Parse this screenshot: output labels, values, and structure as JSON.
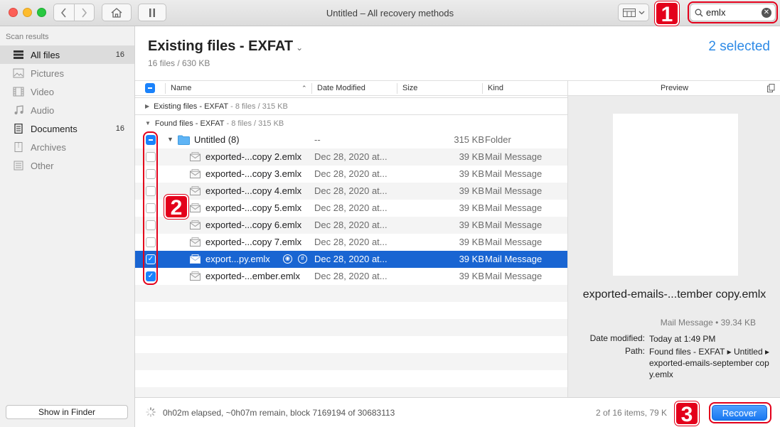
{
  "window": {
    "title": "Untitled – All recovery methods"
  },
  "toolbar": {
    "search_value": "emlx"
  },
  "sidebar": {
    "heading": "Scan results",
    "items": [
      {
        "label": "All files",
        "count": "16",
        "icon": "stack-icon"
      },
      {
        "label": "Pictures",
        "count": "",
        "icon": "picture-icon"
      },
      {
        "label": "Video",
        "count": "",
        "icon": "film-icon"
      },
      {
        "label": "Audio",
        "count": "",
        "icon": "music-note-icon"
      },
      {
        "label": "Documents",
        "count": "16",
        "icon": "document-icon"
      },
      {
        "label": "Archives",
        "count": "",
        "icon": "archive-icon"
      },
      {
        "label": "Other",
        "count": "",
        "icon": "other-icon"
      }
    ],
    "show_in_finder": "Show in Finder"
  },
  "main": {
    "title": "Existing files - EXFAT",
    "subtitle": "16 files / 630 KB",
    "selected": "2 selected"
  },
  "table": {
    "columns": {
      "name": "Name",
      "date": "Date Modified",
      "size": "Size",
      "kind": "Kind"
    },
    "groups": [
      {
        "label": "Existing files - EXFAT",
        "meta": "- 8 files / 315 KB"
      },
      {
        "label": "Found files - EXFAT",
        "meta": "- 8 files / 315 KB"
      }
    ],
    "folder": {
      "name": "Untitled (8)",
      "date": "--",
      "size": "315 KB",
      "kind": "Folder"
    },
    "rows": [
      {
        "name": "exported-...copy 2.emlx",
        "date": "Dec 28, 2020 at...",
        "size": "39 KB",
        "kind": "Mail Message"
      },
      {
        "name": "exported-...copy 3.emlx",
        "date": "Dec 28, 2020 at...",
        "size": "39 KB",
        "kind": "Mail Message"
      },
      {
        "name": "exported-...copy 4.emlx",
        "date": "Dec 28, 2020 at...",
        "size": "39 KB",
        "kind": "Mail Message"
      },
      {
        "name": "exported-...copy 5.emlx",
        "date": "Dec 28, 2020 at...",
        "size": "39 KB",
        "kind": "Mail Message"
      },
      {
        "name": "exported-...copy 6.emlx",
        "date": "Dec 28, 2020 at...",
        "size": "39 KB",
        "kind": "Mail Message"
      },
      {
        "name": "exported-...copy 7.emlx",
        "date": "Dec 28, 2020 at...",
        "size": "39 KB",
        "kind": "Mail Message"
      },
      {
        "name": "export...py.emlx",
        "date": "Dec 28, 2020 at...",
        "size": "39 KB",
        "kind": "Mail Message"
      },
      {
        "name": "exported-...ember.emlx",
        "date": "Dec 28, 2020 at...",
        "size": "39 KB",
        "kind": "Mail Message"
      }
    ]
  },
  "preview": {
    "heading": "Preview",
    "filename": "exported-emails-...tember copy.emlx",
    "kind": "Mail Message • 39.34 KB",
    "date_label": "Date modified:",
    "date_value": "Today at 1:49 PM",
    "path_label": "Path:",
    "path_value": "Found files - EXFAT ▸ Untitled ▸ exported-emails-september copy.emlx"
  },
  "footer": {
    "status": "0h02m elapsed, ~0h07m remain, block 7169194 of 30683113",
    "items": "2 of 16 items, 79 K",
    "recover": "Recover"
  },
  "callouts": [
    "1",
    "2",
    "3"
  ],
  "colors": {
    "accent": "#1a82fb",
    "selection": "#1965d2",
    "callout": "#e3001b"
  }
}
